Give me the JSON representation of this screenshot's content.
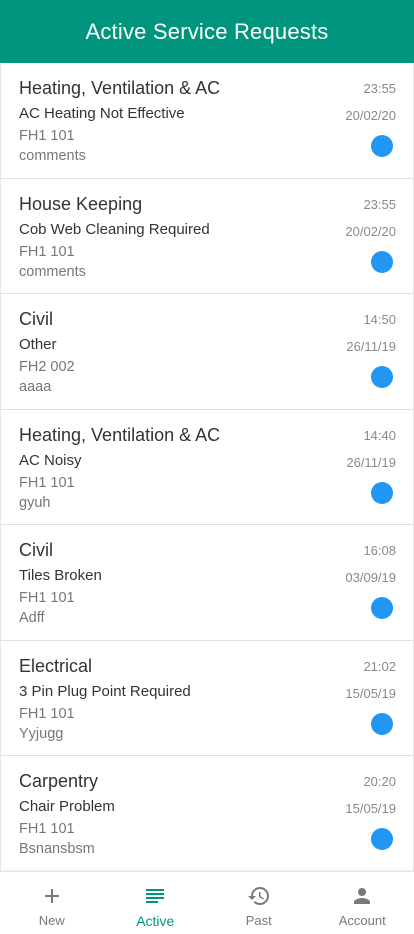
{
  "header": {
    "title": "Active Service Requests"
  },
  "requests": [
    {
      "category": "Heating, Ventilation & AC",
      "time": "23:55",
      "title": "AC Heating Not Effective",
      "date": "20/02/20",
      "room": "FH1 101",
      "comment": "comments"
    },
    {
      "category": "House Keeping",
      "time": "23:55",
      "title": "Cob Web Cleaning Required",
      "date": "20/02/20",
      "room": "FH1 101",
      "comment": "comments"
    },
    {
      "category": "Civil",
      "time": "14:50",
      "title": "Other",
      "date": "26/11/19",
      "room": "FH2 002",
      "comment": "aaaa"
    },
    {
      "category": "Heating, Ventilation & AC",
      "time": "14:40",
      "title": "AC Noisy",
      "date": "26/11/19",
      "room": "FH1 101",
      "comment": "gyuh"
    },
    {
      "category": "Civil",
      "time": "16:08",
      "title": "Tiles Broken",
      "date": "03/09/19",
      "room": "FH1 101",
      "comment": "Adff"
    },
    {
      "category": "Electrical",
      "time": "21:02",
      "title": "3 Pin Plug Point Required",
      "date": "15/05/19",
      "room": "FH1 101",
      "comment": "Yyjugg"
    },
    {
      "category": "Carpentry",
      "time": "20:20",
      "title": "Chair Problem",
      "date": "15/05/19",
      "room": "FH1 101",
      "comment": "Bsnansbsm"
    }
  ],
  "bottom_nav": {
    "items": [
      {
        "label": "New",
        "icon": "plus-icon"
      },
      {
        "label": "Active",
        "icon": "list-icon"
      },
      {
        "label": "Past",
        "icon": "history-icon"
      },
      {
        "label": "Account",
        "icon": "person-icon"
      }
    ],
    "active_index": 1
  },
  "colors": {
    "primary": "#00967e",
    "status_dot": "#2196f3"
  }
}
